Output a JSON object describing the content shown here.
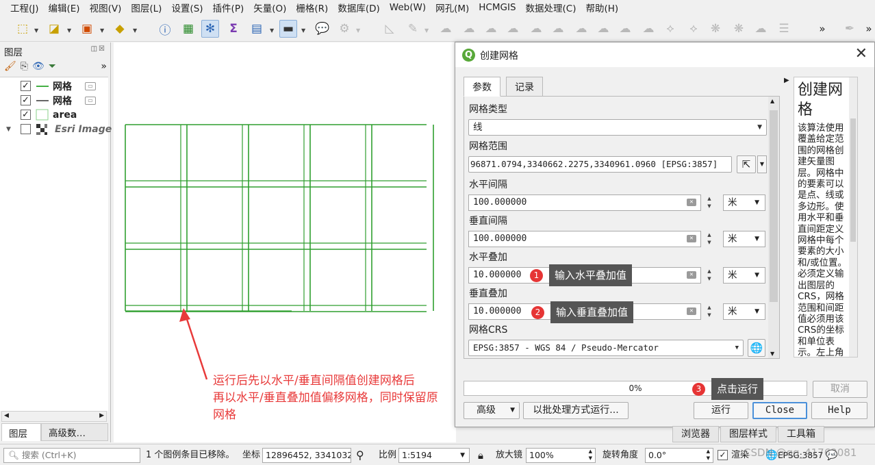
{
  "menu": [
    "工程(J)",
    "编辑(E)",
    "视图(V)",
    "图层(L)",
    "设置(S)",
    "插件(P)",
    "矢量(O)",
    "栅格(R)",
    "数据库(D)",
    "Web(W)",
    "网孔(M)",
    "HCMGIS",
    "数据处理(C)",
    "帮助(H)"
  ],
  "layers_panel": {
    "title": "图层",
    "layers": [
      {
        "name": "网格",
        "checked": true,
        "symbol": "line-green",
        "tag": true
      },
      {
        "name": "网格",
        "checked": true,
        "symbol": "line-gray",
        "tag": true
      },
      {
        "name": "area",
        "checked": true,
        "symbol": "polygon-green",
        "tag": false
      },
      {
        "name": "Esri Image",
        "checked": false,
        "symbol": "raster",
        "tag": false
      }
    ],
    "tabs": [
      "图层",
      "高级数…"
    ]
  },
  "map": {
    "annotation_lines": [
      "运行后先以水平/垂直间隔值创建网格后",
      "再以水平/垂直叠加值偏移网格，同时保留原",
      "网格"
    ],
    "grid_color": "#2e9e2e"
  },
  "dialog": {
    "title": "创建网格",
    "tabs": [
      "参数",
      "记录"
    ],
    "grid_type": {
      "label": "网格类型",
      "value": "线"
    },
    "extent": {
      "label": "网格范围",
      "value": "96871.0794,3340662.2275,3340961.0960 [EPSG:3857]"
    },
    "h_spacing": {
      "label": "水平间隔",
      "value": "100.000000",
      "unit": "米"
    },
    "v_spacing": {
      "label": "垂直间隔",
      "value": "100.000000",
      "unit": "米"
    },
    "h_overlay": {
      "label": "水平叠加",
      "value": "10.000000",
      "unit": "米",
      "badge": "1",
      "callout": "输入水平叠加值"
    },
    "v_overlay": {
      "label": "垂直叠加",
      "value": "10.000000",
      "unit": "米",
      "badge": "2",
      "callout": "输入垂直叠加值"
    },
    "crs": {
      "label": "网格CRS",
      "value": "EPSG:3857 - WGS 84 / Pseudo-Mercator"
    },
    "help_title": "创建网格",
    "help_text": "该算法使用覆盖给定范围的网格创建矢量图层。网格中的要素可以是点、线或多边形。使用水平和垂直间距定义网格中每个要素的大小和/或位置。必须定义输出图层的CRS，网格范围和间距值必须用该CRS的坐标和单位表示。左上角",
    "progress": "0%",
    "run_badge": "3",
    "run_callout": "点击运行",
    "buttons": {
      "cancel": "取消",
      "advanced": "高级",
      "batch": "以批处理方式运行...",
      "run": "运行",
      "close": "Close",
      "help": "Help"
    }
  },
  "dock_tabs": [
    "浏览器",
    "图层样式",
    "工具箱"
  ],
  "statusbar": {
    "search_placeholder": "搜索 (Ctrl+K)",
    "message": "1 个图例条目已移除。",
    "coord_label": "坐标",
    "coord_value": "12896452, 3341032",
    "scale_label": "比例",
    "scale_value": "1:5194",
    "magnifier_label": "放大镜",
    "magnifier_value": "100%",
    "rotation_label": "旋转角度",
    "rotation_value": "0.0°",
    "render_label": "渲染",
    "crs": "EPSG:3857",
    "watermark": "CSDN @qq_41762081"
  }
}
